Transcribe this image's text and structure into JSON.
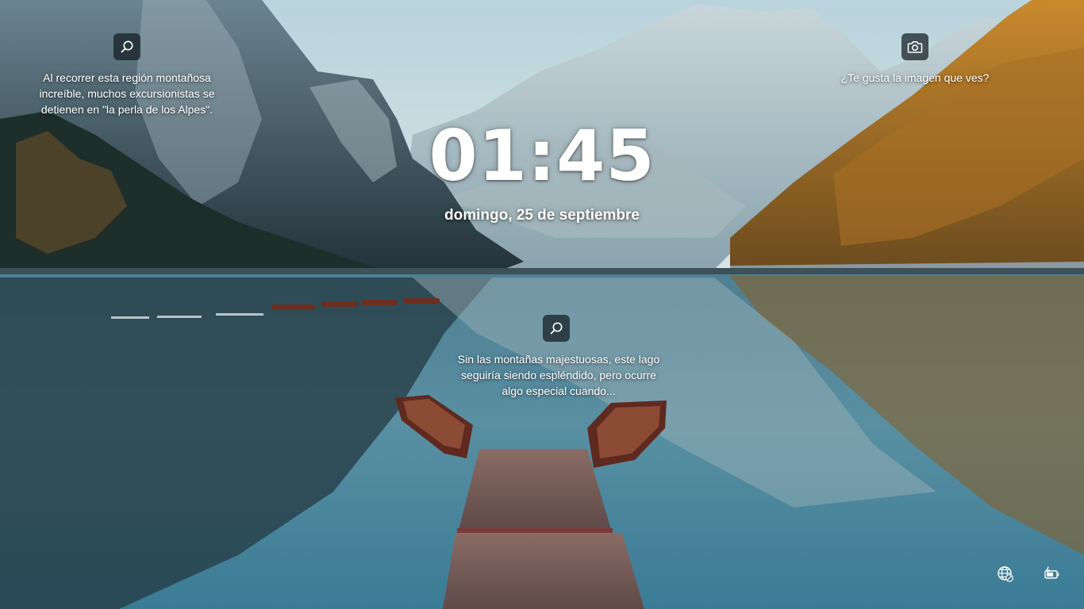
{
  "lockscreen": {
    "time": "01:45",
    "date": "domingo, 25 de septiembre"
  },
  "spotlight": {
    "hotspot_left": {
      "icon": "search-icon",
      "text": "Al recorrer esta región montañosa increíble, muchos excursionistas se detienen en \"la perla de los Alpes\"."
    },
    "hotspot_center": {
      "icon": "search-icon",
      "text": "Sin las montañas majestuosas, este lago seguiría siendo espléndido, pero ocurre algo especial cuando..."
    },
    "like_image": {
      "icon": "camera-icon",
      "text": "¿Te gusta la imagen que ves?"
    }
  },
  "status": {
    "network_icon": "globe-network-icon",
    "battery_icon": "battery-charging-icon"
  }
}
